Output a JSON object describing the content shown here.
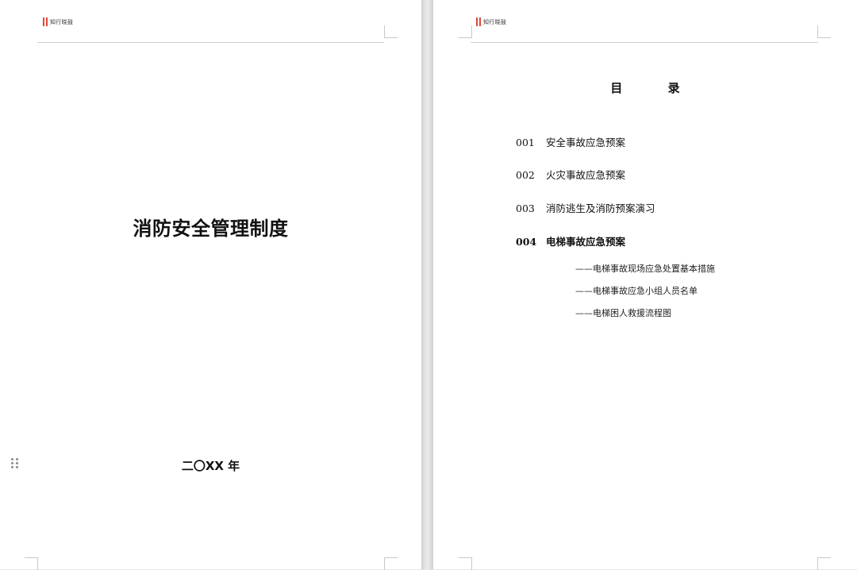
{
  "header": {
    "logo_text": "知行晓鼓"
  },
  "cover": {
    "title": "消防安全管理制度",
    "date": "二〇XX 年"
  },
  "toc": {
    "heading": "目 录",
    "items": [
      {
        "num": "001",
        "label": "安全事故应急预案"
      },
      {
        "num": "002",
        "label": "火灾事故应急预案"
      },
      {
        "num": "003",
        "label": "消防逃生及消防预案演习"
      },
      {
        "num": "004",
        "label": "电梯事故应急预案"
      }
    ],
    "subitems": [
      "——电梯事故现场应急处置基本措施",
      "——电梯事故应急小组人员名单",
      "——电梯困人救援流程图"
    ]
  },
  "colors": {
    "logo_accent": "#e0473a",
    "page_bg": "#ffffff",
    "gutter": "#e6e6e6"
  },
  "icons": {
    "drag_handle": "drag-handle-icon"
  }
}
